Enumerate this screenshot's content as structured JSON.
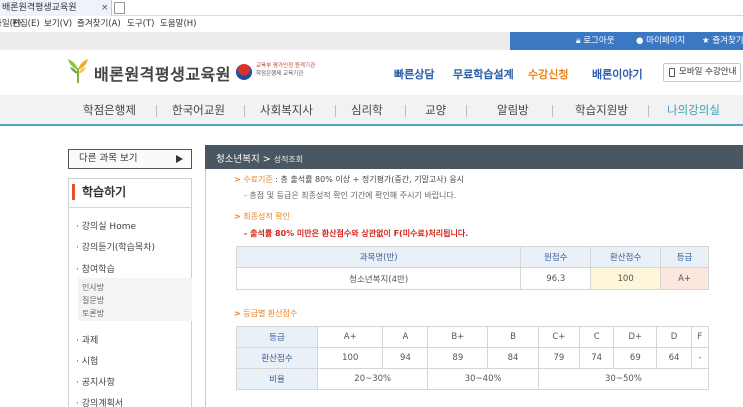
{
  "browser": {
    "tab_title": "배론원격평생교육원",
    "tab_close": "×",
    "menu": [
      "파일(F)",
      "편집(E)",
      "보기(V)",
      "즐겨찾기(A)",
      "도구(T)",
      "도움말(H)"
    ]
  },
  "topbar": {
    "logout": "로그아웃",
    "mypage": "마이페이지",
    "favorite": "즐겨찾기"
  },
  "header": {
    "logo": "배론원격평생교육원",
    "partner_line1": "교육부 평가인정 원격기관",
    "partner_line2": "학점은행제 교육기관",
    "links": [
      "빠른상담",
      "무료학습설계",
      "수강신청",
      "배론이야기"
    ],
    "mobile_button": "모바일 수강안내"
  },
  "mainnav": [
    "학점은행제",
    "한국어교원",
    "사회복지사",
    "심리학",
    "교양",
    "알림방",
    "학습지원방",
    "나의강의실"
  ],
  "sidebar": {
    "other_courses": "다른 과목 보기",
    "title": "학습하기",
    "items": [
      "강의실 Home",
      "강의듣기(학습목차)",
      "참여학습",
      "과제",
      "시험",
      "공지사항",
      "강의계획서"
    ],
    "subitems": [
      "인사방",
      "질문방",
      "토론방"
    ]
  },
  "content": {
    "title": "청소년복지",
    "subtitle": "성적조회",
    "criteria_label": "수료기준",
    "criteria_text": ": 총 출석률 80% 이상 + 정기평가(중간, 기말고사) 응시",
    "criteria_note": "- 총점 및 등급은 최종성적 확인 기간에 확인해 주시기 바랍니다.",
    "final_label": "최종성적 확인",
    "final_warning": "- 출석률 80% 미만은 환산점수와 상관없이 F(미수료)처리됩니다.",
    "score_table": {
      "headers": [
        "과목명(반)",
        "원점수",
        "환산점수",
        "등급"
      ],
      "row": [
        "청소년복지(4반)",
        "96.3",
        "100",
        "A+"
      ]
    },
    "grade_label": "등급별 환산점수",
    "grade_table": {
      "row1_label": "등급",
      "grades": [
        "A+",
        "A",
        "B+",
        "B",
        "C+",
        "C",
        "D+",
        "D",
        "F"
      ],
      "row2_label": "환산점수",
      "scores": [
        "100",
        "94",
        "89",
        "84",
        "79",
        "74",
        "69",
        "64",
        "-"
      ],
      "row3_label": "비율",
      "ratios": [
        "20~30%",
        "30~40%",
        "30~50%"
      ]
    }
  }
}
